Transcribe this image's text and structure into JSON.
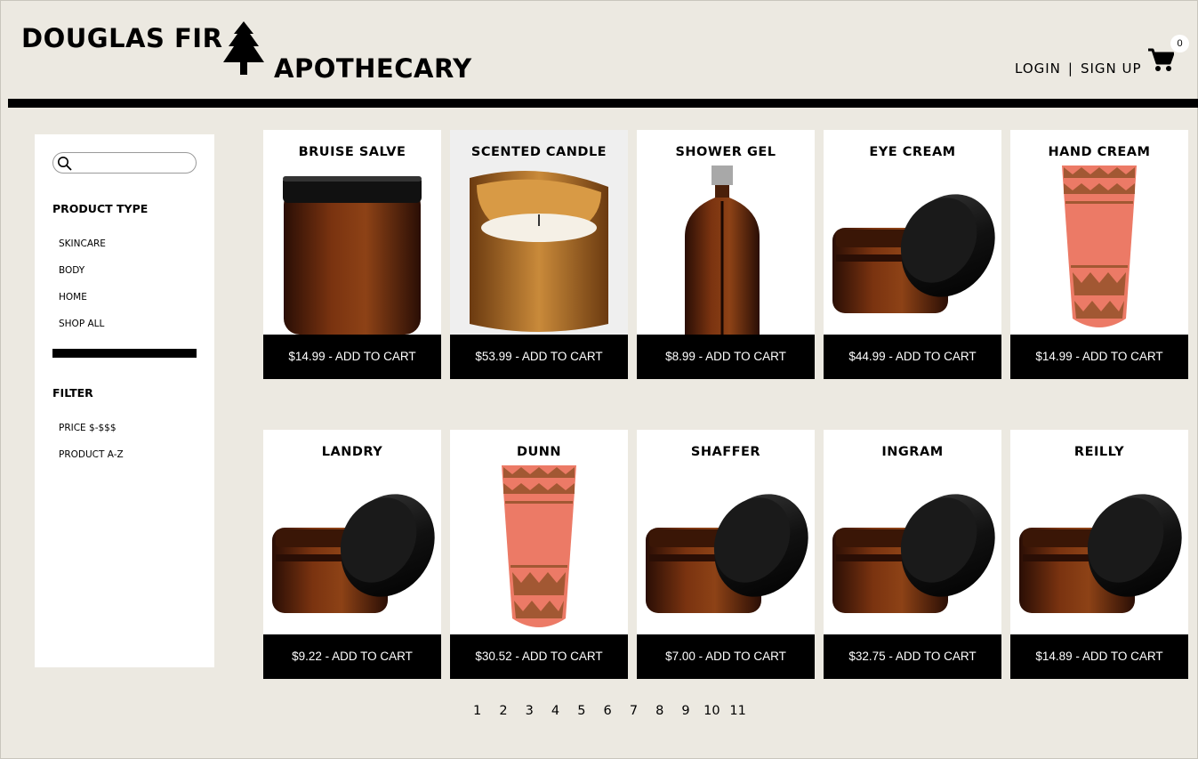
{
  "header": {
    "logo_line1": "DOUGLAS FIR",
    "logo_line2": "APOTHECARY",
    "logo_icon": "pine-tree-icon",
    "login": "LOGIN",
    "separator": "|",
    "signup": "SIGN UP",
    "cart_icon": "shopping-cart-icon",
    "cart_count": "0"
  },
  "sidebar": {
    "search_icon": "magnifier-icon",
    "search_value": "",
    "product_type_heading": "PRODUCT TYPE",
    "product_types": [
      "SKINCARE",
      "BODY",
      "HOME",
      "SHOP ALL"
    ],
    "filter_heading": "FILTER",
    "filters": [
      "PRICE $-$$$",
      "PRODUCT A-Z"
    ]
  },
  "products": [
    {
      "name": "BRUISE SALVE",
      "button": "$14.99 - ADD TO CART",
      "image": "amber-jar"
    },
    {
      "name": "SCENTED CANDLE",
      "button": "$53.99 - ADD TO CART",
      "image": "candle"
    },
    {
      "name": "SHOWER GEL",
      "button": "$8.99 - ADD TO CART",
      "image": "pump-bottle"
    },
    {
      "name": "EYE CREAM",
      "button": "$44.99 - ADD TO CART",
      "image": "open-jar"
    },
    {
      "name": "HAND CREAM",
      "button": "$14.99 - ADD TO CART",
      "image": "tube"
    },
    {
      "name": "LANDRY",
      "button": "$9.22 - ADD TO CART",
      "image": "open-jar"
    },
    {
      "name": "DUNN",
      "button": "$30.52 - ADD TO CART",
      "image": "tube"
    },
    {
      "name": "SHAFFER",
      "button": "$7.00 - ADD TO CART",
      "image": "open-jar"
    },
    {
      "name": "INGRAM",
      "button": "$32.75 - ADD TO CART",
      "image": "open-jar"
    },
    {
      "name": "REILLY",
      "button": "$14.89 - ADD TO CART",
      "image": "open-jar"
    }
  ],
  "pagination": [
    "1",
    "2",
    "3",
    "4",
    "5",
    "6",
    "7",
    "8",
    "9",
    "10",
    "11"
  ],
  "colors": {
    "page_background": "#ece9e1",
    "accent": "#000000",
    "button_text": "#ffffff",
    "amber": "#8a3a0e",
    "tube_coral": "#ec7a66"
  }
}
